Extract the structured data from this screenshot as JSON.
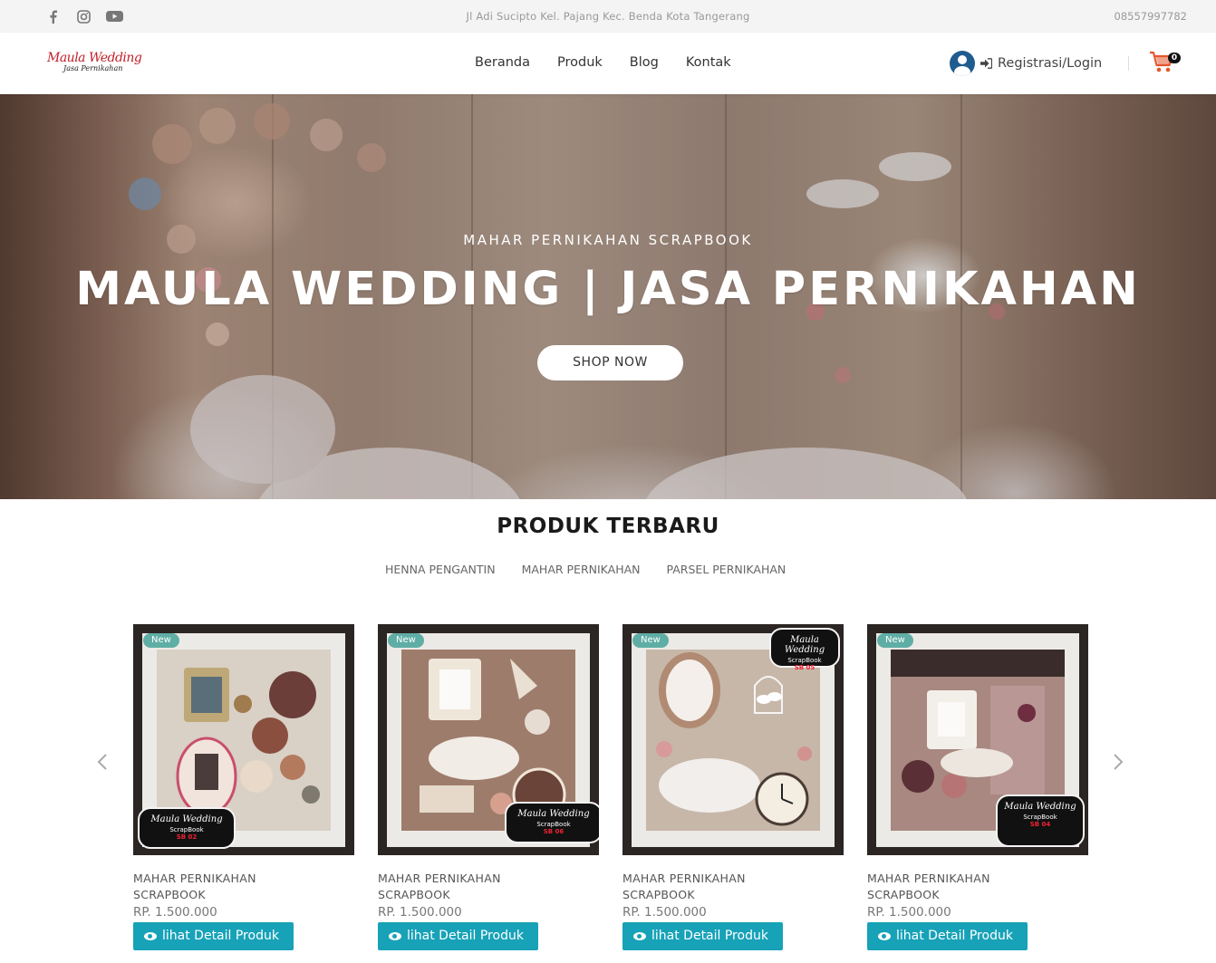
{
  "topbar": {
    "address": "Jl Adi Sucipto Kel. Pajang Kec. Benda Kota Tangerang",
    "phone": "08557997782",
    "socials": [
      "facebook-icon",
      "instagram-icon",
      "youtube-icon"
    ]
  },
  "header": {
    "logo_line1": "Maula Wedding",
    "logo_line2": "Jasa Pernikahan",
    "nav": [
      "Beranda",
      "Produk",
      "Blog",
      "Kontak"
    ],
    "login_label": "Registrasi/Login",
    "cart_count": "0"
  },
  "hero": {
    "subtitle": "MAHAR PERNIKAHAN SCRAPBOOK",
    "title": "MAULA WEDDING | JASA PERNIKAHAN",
    "button": "SHOP NOW"
  },
  "products": {
    "section_title": "PRODUK TERBARU",
    "filters": [
      "HENNA PENGANTIN",
      "MAHAR PERNIKAHAN",
      "PARSEL PERNIKAHAN"
    ],
    "items": [
      {
        "badge": "New",
        "name_line1": "MAHAR PERNIKAHAN",
        "name_line2": "SCRAPBOOK",
        "price": "RP. 1.500.000",
        "button": "lihat Detail Produk",
        "plaque_brand": "Maula Wedding",
        "plaque_sub": "ScrapBook",
        "plaque_code": "SB 02"
      },
      {
        "badge": "New",
        "name_line1": "MAHAR PERNIKAHAN",
        "name_line2": "SCRAPBOOK",
        "price": "RP. 1.500.000",
        "button": "lihat Detail Produk",
        "plaque_brand": "Maula Wedding",
        "plaque_sub": "ScrapBook",
        "plaque_code": "SB 06"
      },
      {
        "badge": "New",
        "name_line1": "MAHAR PERNIKAHAN",
        "name_line2": "SCRAPBOOK",
        "price": "RP. 1.500.000",
        "button": "lihat Detail Produk",
        "plaque_brand": "Maula Wedding",
        "plaque_sub": "ScrapBook",
        "plaque_code": "SB 05"
      },
      {
        "badge": "New",
        "name_line1": "MAHAR PERNIKAHAN",
        "name_line2": "SCRAPBOOK",
        "price": "RP. 1.500.000",
        "button": "lihat Detail Produk",
        "plaque_brand": "Maula Wedding",
        "plaque_sub": "ScrapBook",
        "plaque_code": "SB 04"
      }
    ]
  },
  "colors": {
    "accent": "#17a2b8",
    "badge": "#5faea5",
    "avatar": "#1f5c8f",
    "cart": "#e4572e"
  }
}
